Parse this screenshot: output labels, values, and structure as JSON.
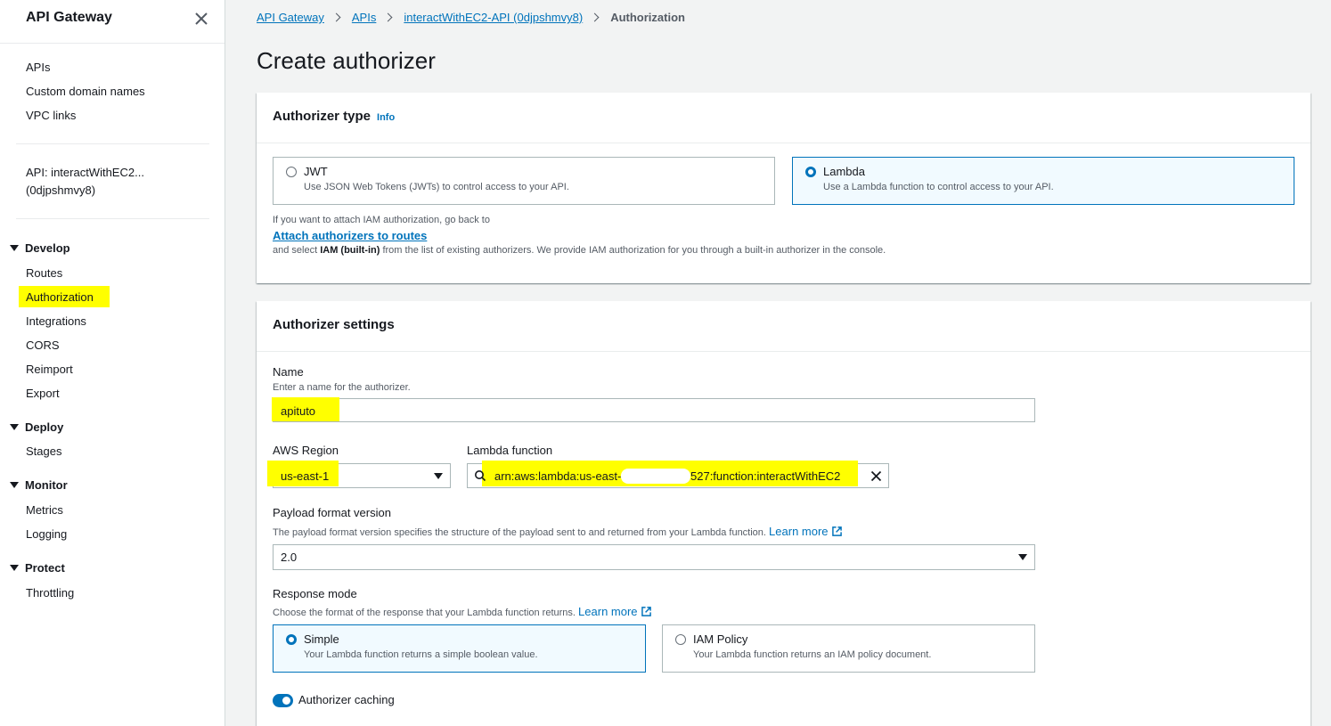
{
  "sidebar": {
    "title": "API Gateway",
    "close_icon": "close-icon",
    "top_links": [
      "APIs",
      "Custom domain names",
      "VPC links"
    ],
    "api_name_line1": "API: interactWithEC2...",
    "api_name_line2": "(0djpshmvy8)",
    "sections": {
      "develop": {
        "label": "Develop",
        "items": [
          "Routes",
          "Authorization",
          "Integrations",
          "CORS",
          "Reimport",
          "Export"
        ]
      },
      "deploy": {
        "label": "Deploy",
        "items": [
          "Stages"
        ]
      },
      "monitor": {
        "label": "Monitor",
        "items": [
          "Metrics",
          "Logging"
        ]
      },
      "protect": {
        "label": "Protect",
        "items": [
          "Throttling"
        ]
      }
    },
    "active_item": "Authorization",
    "highlight_color": "#ffff00"
  },
  "breadcrumb": {
    "items": [
      "API Gateway",
      "APIs",
      "interactWithEC2-API (0djpshmvy8)"
    ],
    "current": "Authorization"
  },
  "page_title": "Create authorizer",
  "authorizer_type": {
    "title": "Authorizer type",
    "info": "Info",
    "options": [
      {
        "label": "JWT",
        "description": "Use JSON Web Tokens (JWTs) to control access to your API.",
        "selected": false
      },
      {
        "label": "Lambda",
        "description": "Use a Lambda function to control access to your API.",
        "selected": true
      }
    ],
    "note_before": "If you want to attach IAM authorization, go back to",
    "note_link": "Attach authorizers to routes",
    "note_after_1": "and select ",
    "note_after_bold": "IAM (built-in)",
    "note_after_2": " from the list of existing authorizers. We provide IAM authorization for you through a built-in authorizer in the console."
  },
  "authorizer_settings": {
    "title": "Authorizer settings",
    "name": {
      "label": "Name",
      "description": "Enter a name for the authorizer.",
      "value": "apituto"
    },
    "region": {
      "label": "AWS Region",
      "value": "us-east-1"
    },
    "lambda_function": {
      "label": "Lambda function",
      "value_prefix": "arn:aws:lambda:us-east-1",
      "value_suffix": "527:function:interactWithEC2"
    },
    "payload_format": {
      "label": "Payload format version",
      "description": "The payload format version specifies the structure of the payload sent to and returned from your Lambda function.",
      "learn_more": "Learn more",
      "value": "2.0"
    },
    "response_mode": {
      "label": "Response mode",
      "description": "Choose the format of the response that your Lambda function returns.",
      "learn_more": "Learn more",
      "options": [
        {
          "label": "Simple",
          "description": "Your Lambda function returns a simple boolean value.",
          "selected": true
        },
        {
          "label": "IAM Policy",
          "description": "Your Lambda function returns an IAM policy document.",
          "selected": false
        }
      ]
    },
    "caching": {
      "label": "Authorizer caching",
      "enabled": true
    }
  },
  "colors": {
    "link": "#0073bb",
    "selected_border": "#0073bb",
    "selected_bg": "#f1faff",
    "highlight": "#ffff00"
  }
}
